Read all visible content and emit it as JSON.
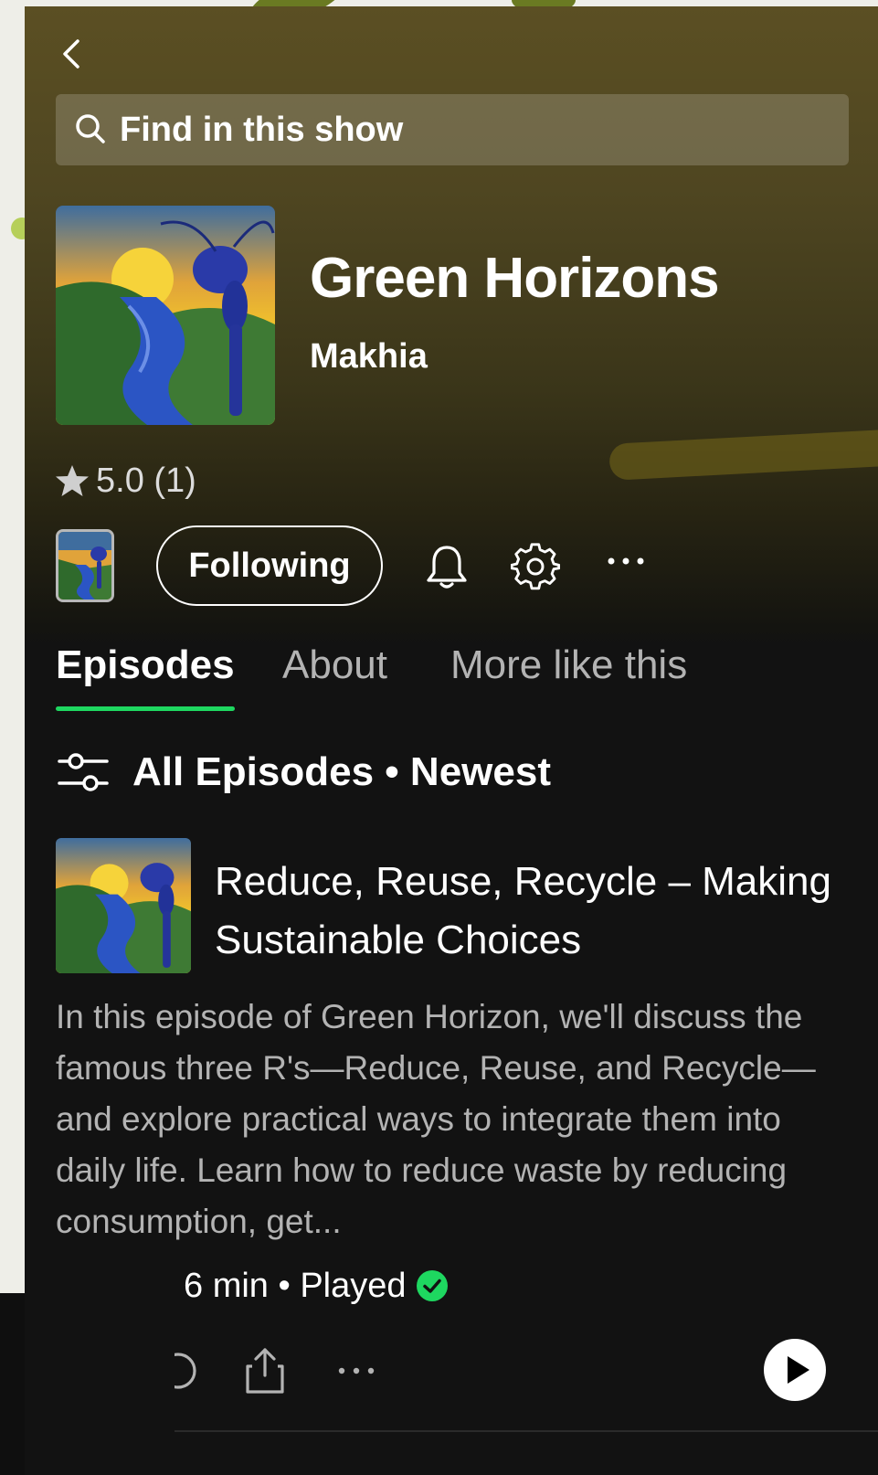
{
  "colors": {
    "accent_green": "#1ed760",
    "played_check": "#1ed760",
    "background": "#121212",
    "header_tint": "#5b4f23",
    "text_primary": "#ffffff",
    "text_secondary": "#b3b3b3"
  },
  "nav": {
    "back_icon": "chevron-left-icon"
  },
  "search": {
    "icon": "search-icon",
    "placeholder": "Find in this show"
  },
  "show": {
    "cover_icon": "podcast-cover-art",
    "title": "Green Horizons",
    "author": "Makhia",
    "rating": {
      "icon": "star-icon",
      "text": "5.0 (1)"
    }
  },
  "actions": {
    "thumb_icon": "podcast-cover-art",
    "following_label": "Following",
    "bell_icon": "bell-icon",
    "settings_icon": "gear-icon",
    "more_icon": "more-horizontal-icon"
  },
  "tabs": [
    {
      "label": "Episodes",
      "active": true
    },
    {
      "label": "About",
      "active": false
    },
    {
      "label": "More like this",
      "active": false
    }
  ],
  "filter": {
    "icon": "sliders-icon",
    "label": "All Episodes • Newest"
  },
  "episodes": [
    {
      "thumb_icon": "podcast-cover-art",
      "title": "Reduce, Reuse, Recycle – Making Sustainable Choices",
      "description": "In this episode of Green Horizon, we'll discuss the famous three R's—Reduce, Reuse, and Recycle—and explore practical ways to integrate them into daily life. Learn how to reduce waste by reducing consumption, get...",
      "meta": "6 min • Played",
      "played_icon": "check-circle-icon",
      "share_icon": "share-icon",
      "more_icon": "more-horizontal-icon",
      "play_icon": "play-circle-icon"
    }
  ]
}
